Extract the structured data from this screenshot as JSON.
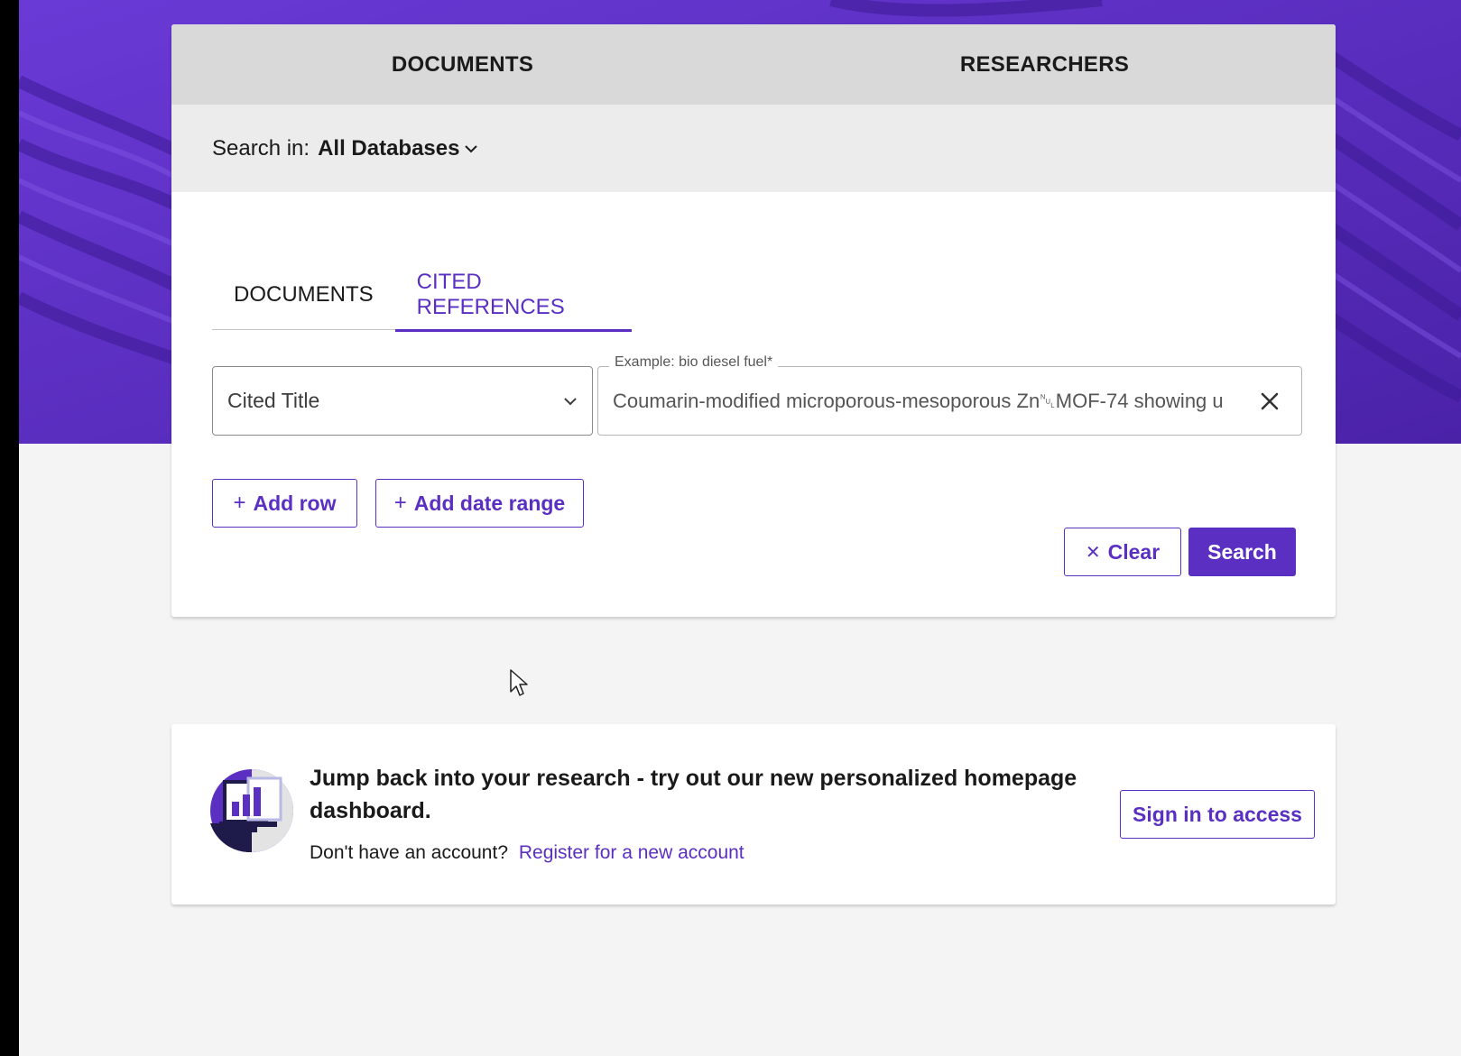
{
  "colors": {
    "accent": "#5a2fc2",
    "hero_background": "#5a2fc2",
    "page_background": "#f4f4f4",
    "tab_bar": "#d9d9d9"
  },
  "top_tabs": [
    {
      "label": "DOCUMENTS"
    },
    {
      "label": "RESEARCHERS"
    }
  ],
  "search_in": {
    "label": "Search in:",
    "value": "All Databases",
    "icon": "chevron-down-icon"
  },
  "sub_tabs": [
    {
      "label": "DOCUMENTS",
      "active": false
    },
    {
      "label": "CITED REFERENCES",
      "active": true
    }
  ],
  "field_select": {
    "value": "Cited Title",
    "icon": "chevron-down-icon"
  },
  "query_input": {
    "legend": "Example: bio diesel fuel*",
    "value": "Coumarin-modified  microporous-mesoporous Zn␀MOF-74 showing u",
    "clear_icon": "close-icon"
  },
  "buttons": {
    "add_row": "Add row",
    "add_date_range": "Add date range",
    "clear": "Clear",
    "search": "Search",
    "plus_glyph": "+",
    "clear_glyph": "✕"
  },
  "promo": {
    "icon": "dashboard-chart-icon",
    "headline": "Jump back into your research - try out our new personalized homepage dashboard.",
    "no_account_text": "Don't have an account?",
    "register_link": "Register for a new account",
    "sign_in_button": "Sign in to access"
  }
}
